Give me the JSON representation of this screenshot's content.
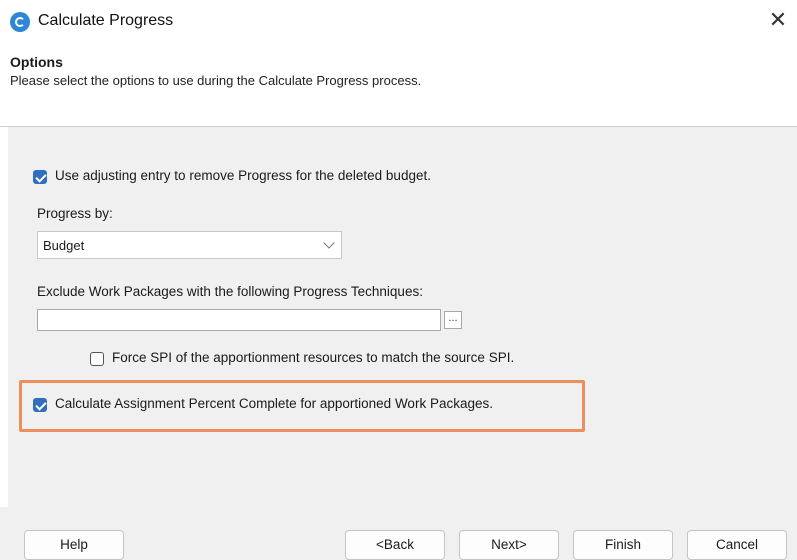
{
  "window": {
    "title": "Calculate Progress",
    "close_glyph": "✕"
  },
  "header": {
    "title": "Options",
    "description": "Please select the options to use during the Calculate Progress process."
  },
  "options": {
    "adjusting_entry": {
      "label": "Use adjusting entry to remove Progress for the deleted budget.",
      "checked": true
    },
    "progress_by": {
      "label": "Progress by:",
      "value": "Budget"
    },
    "exclude_techniques": {
      "label": "Exclude Work Packages with the following Progress Techniques:",
      "value": "",
      "browse_label": "..."
    },
    "force_spi": {
      "label": "Force SPI of the apportionment resources to match the source SPI.",
      "checked": false
    },
    "calc_assignment": {
      "label": "Calculate Assignment Percent Complete for apportioned Work Packages.",
      "checked": true
    }
  },
  "footer": {
    "help": "Help",
    "back": "<Back",
    "next": "Next>",
    "finish": "Finish",
    "cancel": "Cancel"
  },
  "colors": {
    "accent": "#2f6fbd",
    "highlight": "#ec8f5c",
    "panel": "#f0f0f0"
  },
  "icons": {
    "app": "calculate-progress-app-icon",
    "close": "close-icon",
    "dropdown": "chevron-down-icon",
    "check": "checkmark-icon"
  }
}
